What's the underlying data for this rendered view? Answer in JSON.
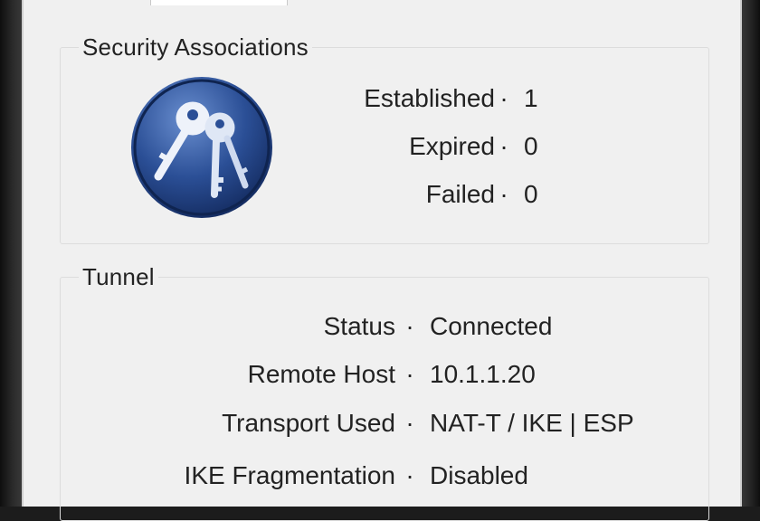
{
  "security_associations": {
    "title": "Security Associations",
    "icon": "keys-icon",
    "rows": [
      {
        "label": "Established",
        "value": "1"
      },
      {
        "label": "Expired",
        "value": "0"
      },
      {
        "label": "Failed",
        "value": "0"
      }
    ]
  },
  "tunnel": {
    "title": "Tunnel",
    "rows": [
      {
        "label": "Status",
        "value": "Connected"
      },
      {
        "label": "Remote Host",
        "value": "10.1.1.20"
      },
      {
        "label": "Transport Used",
        "value": "NAT-T / IKE | ESP"
      },
      {
        "label": "IKE Fragmentation",
        "value": "Disabled"
      }
    ]
  },
  "separator": "·",
  "colors": {
    "icon_dark": "#1d3a78",
    "icon_light": "#4d74b8",
    "panel": "#f0f0f0",
    "text": "#222222"
  }
}
